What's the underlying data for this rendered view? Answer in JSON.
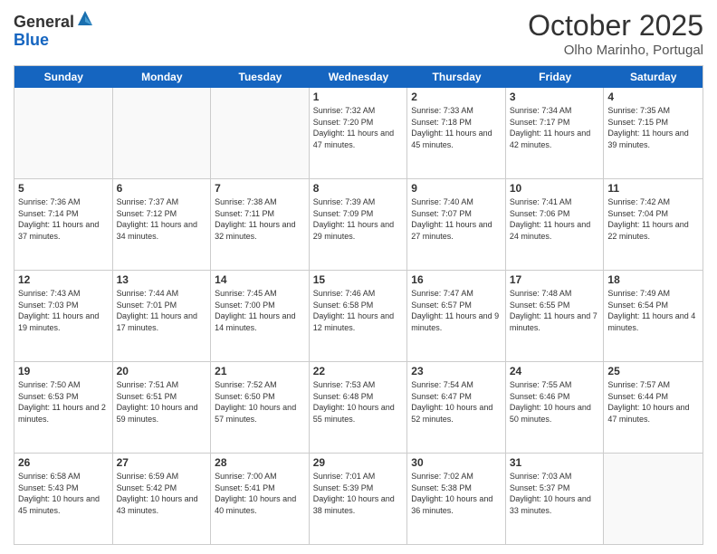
{
  "logo": {
    "general": "General",
    "blue": "Blue"
  },
  "header": {
    "month": "October 2025",
    "location": "Olho Marinho, Portugal"
  },
  "days": [
    "Sunday",
    "Monday",
    "Tuesday",
    "Wednesday",
    "Thursday",
    "Friday",
    "Saturday"
  ],
  "weeks": [
    [
      {
        "day": "",
        "empty": true
      },
      {
        "day": "",
        "empty": true
      },
      {
        "day": "",
        "empty": true
      },
      {
        "day": "1",
        "sunrise": "Sunrise: 7:32 AM",
        "sunset": "Sunset: 7:20 PM",
        "daylight": "Daylight: 11 hours and 47 minutes."
      },
      {
        "day": "2",
        "sunrise": "Sunrise: 7:33 AM",
        "sunset": "Sunset: 7:18 PM",
        "daylight": "Daylight: 11 hours and 45 minutes."
      },
      {
        "day": "3",
        "sunrise": "Sunrise: 7:34 AM",
        "sunset": "Sunset: 7:17 PM",
        "daylight": "Daylight: 11 hours and 42 minutes."
      },
      {
        "day": "4",
        "sunrise": "Sunrise: 7:35 AM",
        "sunset": "Sunset: 7:15 PM",
        "daylight": "Daylight: 11 hours and 39 minutes."
      }
    ],
    [
      {
        "day": "5",
        "sunrise": "Sunrise: 7:36 AM",
        "sunset": "Sunset: 7:14 PM",
        "daylight": "Daylight: 11 hours and 37 minutes."
      },
      {
        "day": "6",
        "sunrise": "Sunrise: 7:37 AM",
        "sunset": "Sunset: 7:12 PM",
        "daylight": "Daylight: 11 hours and 34 minutes."
      },
      {
        "day": "7",
        "sunrise": "Sunrise: 7:38 AM",
        "sunset": "Sunset: 7:11 PM",
        "daylight": "Daylight: 11 hours and 32 minutes."
      },
      {
        "day": "8",
        "sunrise": "Sunrise: 7:39 AM",
        "sunset": "Sunset: 7:09 PM",
        "daylight": "Daylight: 11 hours and 29 minutes."
      },
      {
        "day": "9",
        "sunrise": "Sunrise: 7:40 AM",
        "sunset": "Sunset: 7:07 PM",
        "daylight": "Daylight: 11 hours and 27 minutes."
      },
      {
        "day": "10",
        "sunrise": "Sunrise: 7:41 AM",
        "sunset": "Sunset: 7:06 PM",
        "daylight": "Daylight: 11 hours and 24 minutes."
      },
      {
        "day": "11",
        "sunrise": "Sunrise: 7:42 AM",
        "sunset": "Sunset: 7:04 PM",
        "daylight": "Daylight: 11 hours and 22 minutes."
      }
    ],
    [
      {
        "day": "12",
        "sunrise": "Sunrise: 7:43 AM",
        "sunset": "Sunset: 7:03 PM",
        "daylight": "Daylight: 11 hours and 19 minutes."
      },
      {
        "day": "13",
        "sunrise": "Sunrise: 7:44 AM",
        "sunset": "Sunset: 7:01 PM",
        "daylight": "Daylight: 11 hours and 17 minutes."
      },
      {
        "day": "14",
        "sunrise": "Sunrise: 7:45 AM",
        "sunset": "Sunset: 7:00 PM",
        "daylight": "Daylight: 11 hours and 14 minutes."
      },
      {
        "day": "15",
        "sunrise": "Sunrise: 7:46 AM",
        "sunset": "Sunset: 6:58 PM",
        "daylight": "Daylight: 11 hours and 12 minutes."
      },
      {
        "day": "16",
        "sunrise": "Sunrise: 7:47 AM",
        "sunset": "Sunset: 6:57 PM",
        "daylight": "Daylight: 11 hours and 9 minutes."
      },
      {
        "day": "17",
        "sunrise": "Sunrise: 7:48 AM",
        "sunset": "Sunset: 6:55 PM",
        "daylight": "Daylight: 11 hours and 7 minutes."
      },
      {
        "day": "18",
        "sunrise": "Sunrise: 7:49 AM",
        "sunset": "Sunset: 6:54 PM",
        "daylight": "Daylight: 11 hours and 4 minutes."
      }
    ],
    [
      {
        "day": "19",
        "sunrise": "Sunrise: 7:50 AM",
        "sunset": "Sunset: 6:53 PM",
        "daylight": "Daylight: 11 hours and 2 minutes."
      },
      {
        "day": "20",
        "sunrise": "Sunrise: 7:51 AM",
        "sunset": "Sunset: 6:51 PM",
        "daylight": "Daylight: 10 hours and 59 minutes."
      },
      {
        "day": "21",
        "sunrise": "Sunrise: 7:52 AM",
        "sunset": "Sunset: 6:50 PM",
        "daylight": "Daylight: 10 hours and 57 minutes."
      },
      {
        "day": "22",
        "sunrise": "Sunrise: 7:53 AM",
        "sunset": "Sunset: 6:48 PM",
        "daylight": "Daylight: 10 hours and 55 minutes."
      },
      {
        "day": "23",
        "sunrise": "Sunrise: 7:54 AM",
        "sunset": "Sunset: 6:47 PM",
        "daylight": "Daylight: 10 hours and 52 minutes."
      },
      {
        "day": "24",
        "sunrise": "Sunrise: 7:55 AM",
        "sunset": "Sunset: 6:46 PM",
        "daylight": "Daylight: 10 hours and 50 minutes."
      },
      {
        "day": "25",
        "sunrise": "Sunrise: 7:57 AM",
        "sunset": "Sunset: 6:44 PM",
        "daylight": "Daylight: 10 hours and 47 minutes."
      }
    ],
    [
      {
        "day": "26",
        "sunrise": "Sunrise: 6:58 AM",
        "sunset": "Sunset: 5:43 PM",
        "daylight": "Daylight: 10 hours and 45 minutes."
      },
      {
        "day": "27",
        "sunrise": "Sunrise: 6:59 AM",
        "sunset": "Sunset: 5:42 PM",
        "daylight": "Daylight: 10 hours and 43 minutes."
      },
      {
        "day": "28",
        "sunrise": "Sunrise: 7:00 AM",
        "sunset": "Sunset: 5:41 PM",
        "daylight": "Daylight: 10 hours and 40 minutes."
      },
      {
        "day": "29",
        "sunrise": "Sunrise: 7:01 AM",
        "sunset": "Sunset: 5:39 PM",
        "daylight": "Daylight: 10 hours and 38 minutes."
      },
      {
        "day": "30",
        "sunrise": "Sunrise: 7:02 AM",
        "sunset": "Sunset: 5:38 PM",
        "daylight": "Daylight: 10 hours and 36 minutes."
      },
      {
        "day": "31",
        "sunrise": "Sunrise: 7:03 AM",
        "sunset": "Sunset: 5:37 PM",
        "daylight": "Daylight: 10 hours and 33 minutes."
      },
      {
        "day": "",
        "empty": true
      }
    ]
  ]
}
